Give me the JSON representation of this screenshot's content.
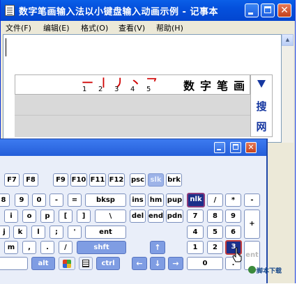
{
  "notepad": {
    "title": "数字笔画输入法以小键盘输入动画示例 - 记事本",
    "menu": [
      "文件(F)",
      "编辑(E)",
      "格式(O)",
      "查看(V)",
      "帮助(H)"
    ]
  },
  "stroke_panel": {
    "strokes": [
      {
        "glyph": "一",
        "num": "1"
      },
      {
        "glyph": "丨",
        "num": "2"
      },
      {
        "glyph": "丿",
        "num": "3"
      },
      {
        "glyph": "丶",
        "num": "4"
      },
      {
        "glyph": "乛",
        "num": "5"
      }
    ],
    "heading_chars": [
      "数",
      "字",
      "笔",
      "画"
    ],
    "side_chars": [
      "搜",
      "网"
    ]
  },
  "osk": {
    "rows": [
      {
        "name": "function-row",
        "keys": [
          "F7",
          "F8",
          "F9",
          "F10",
          "F11",
          "F12",
          "psc",
          "slk",
          "brk"
        ]
      },
      {
        "name": "number-row",
        "keys": [
          "8",
          "9",
          "0",
          "-",
          "=",
          "bksp",
          "ins",
          "hm",
          "pup",
          "nlk",
          "/",
          "*",
          "-"
        ]
      },
      {
        "name": "upper-row",
        "keys": [
          "i",
          "o",
          "p",
          "[",
          "]",
          "\\",
          "del",
          "end",
          "pdn",
          "7",
          "8",
          "9",
          "+"
        ]
      },
      {
        "name": "home-row",
        "keys": [
          "j",
          "k",
          "l",
          ";",
          "'",
          "ent",
          "4",
          "5",
          "6"
        ]
      },
      {
        "name": "lower-row",
        "keys": [
          "m",
          ",",
          ".",
          "/",
          "shft",
          "↑",
          "1",
          "2",
          "3"
        ]
      },
      {
        "name": "bottom-row",
        "keys": [
          "",
          "alt",
          "ctrl",
          "←",
          "↓",
          "→",
          "0",
          ".",
          "ent"
        ]
      }
    ]
  },
  "watermark": "脚本下载",
  "colors": {
    "xp_blue": "#0450dc",
    "stroke_red": "#d00000",
    "sidebar_blue": "#1637a0",
    "key_mod": "#7f9de3",
    "key_active": "#1b2f8a"
  }
}
